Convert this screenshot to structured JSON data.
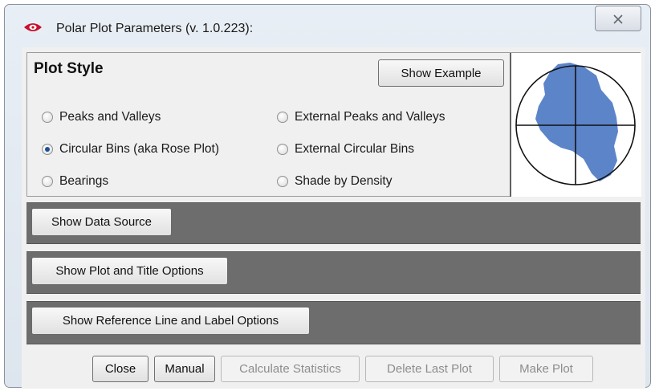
{
  "window": {
    "title": "Polar Plot Parameters (v. 1.0.223):",
    "close_glyph": "✕",
    "icon": "app-eye-icon"
  },
  "plot_style": {
    "heading": "Plot Style",
    "show_example_label": "Show Example",
    "options": [
      {
        "label": "Peaks and Valleys",
        "selected": false
      },
      {
        "label": "Circular Bins (aka Rose Plot)",
        "selected": true
      },
      {
        "label": "Bearings",
        "selected": false
      },
      {
        "label": "External Peaks and Valleys",
        "selected": false
      },
      {
        "label": "External Circular Bins",
        "selected": false
      },
      {
        "label": "Shade by Density",
        "selected": false
      }
    ]
  },
  "sections": {
    "data_source_label": "Show Data Source",
    "plot_title_label": "Show Plot and Title Options",
    "reference_line_label": "Show Reference Line and Label Options"
  },
  "footer": {
    "close_label": "Close",
    "manual_label": "Manual",
    "calculate_label": "Calculate Statistics",
    "delete_label": "Delete Last Plot",
    "make_plot_label": "Make Plot"
  },
  "colors": {
    "rose_fill": "#5c84c9",
    "section_bg": "#6d6d6d",
    "icon_red": "#c8102e"
  }
}
